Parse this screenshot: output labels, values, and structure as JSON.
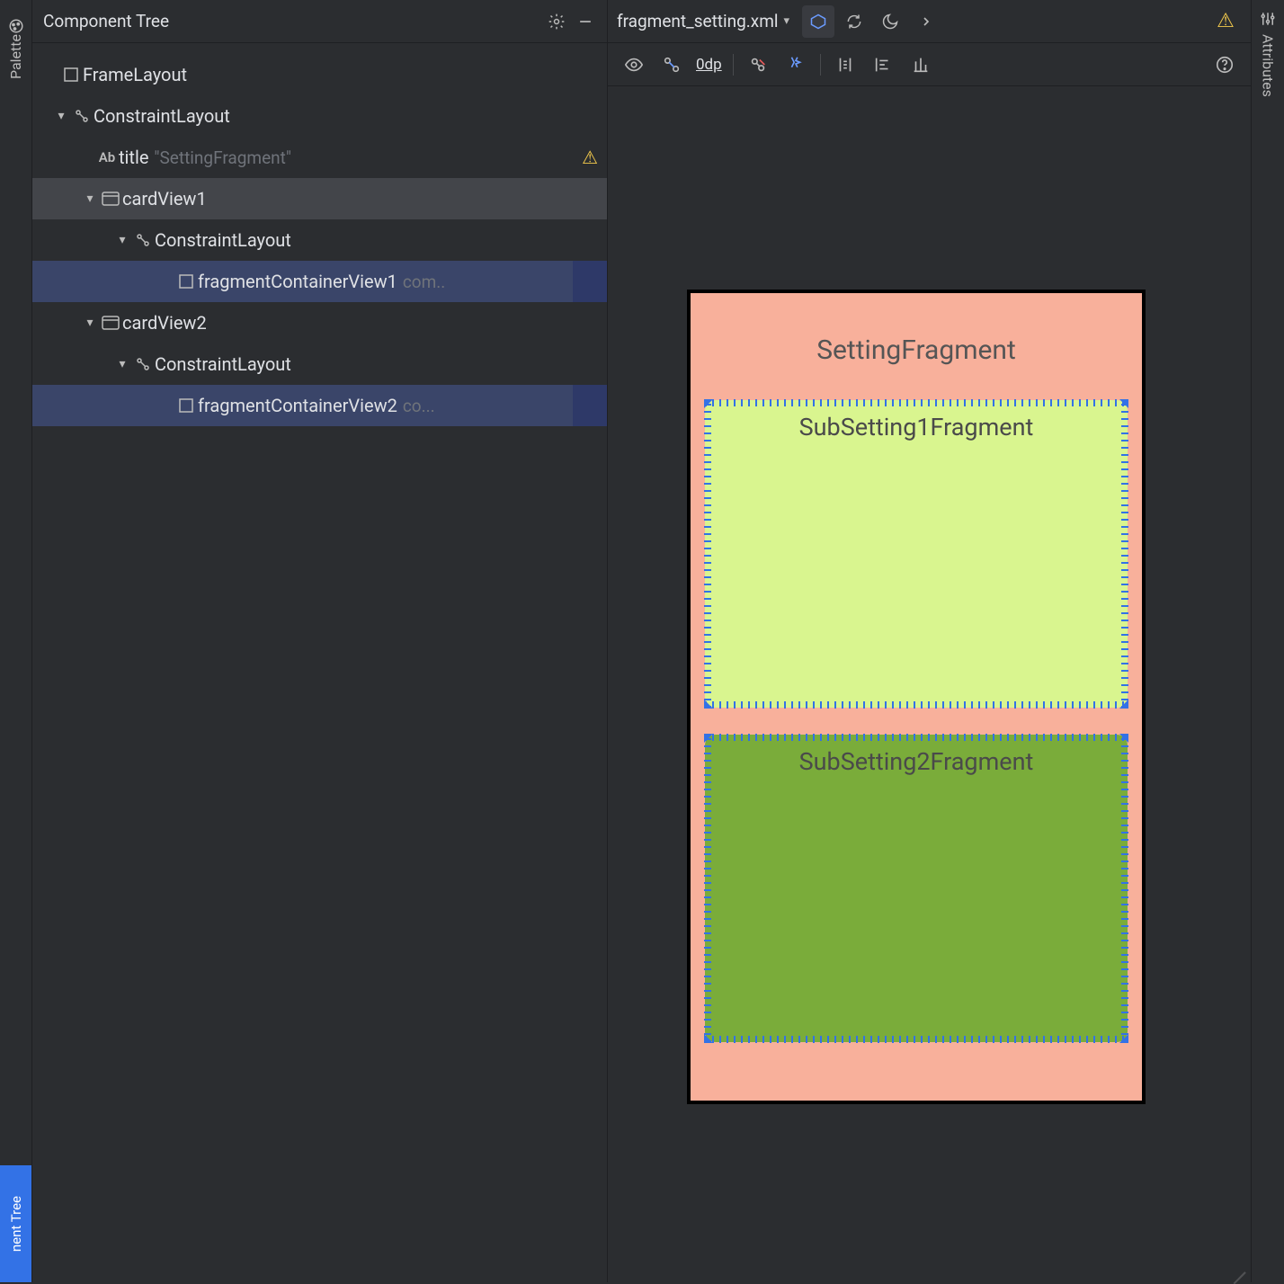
{
  "leftRail": {
    "label": "Palette",
    "bottomLabel": "nent Tree"
  },
  "rightRail": {
    "label": "Attributes"
  },
  "treeHeader": {
    "title": "Component Tree"
  },
  "tree": {
    "items": [
      {
        "label": "FrameLayout",
        "hint": ""
      },
      {
        "label": "ConstraintLayout",
        "hint": ""
      },
      {
        "label": "title",
        "hint": "\"SettingFragment\""
      },
      {
        "label": "cardView1",
        "hint": ""
      },
      {
        "label": "ConstraintLayout",
        "hint": ""
      },
      {
        "label": "fragmentContainerView1",
        "hint": "com.."
      },
      {
        "label": "cardView2",
        "hint": ""
      },
      {
        "label": "ConstraintLayout",
        "hint": ""
      },
      {
        "label": "fragmentContainerView2",
        "hint": "co..."
      }
    ]
  },
  "editor": {
    "fileName": "fragment_setting.xml",
    "toolbar": {
      "defaultMargin": "0dp"
    }
  },
  "device": {
    "title": "SettingFragment",
    "card1": "SubSetting1Fragment",
    "card2": "SubSetting2Fragment"
  }
}
